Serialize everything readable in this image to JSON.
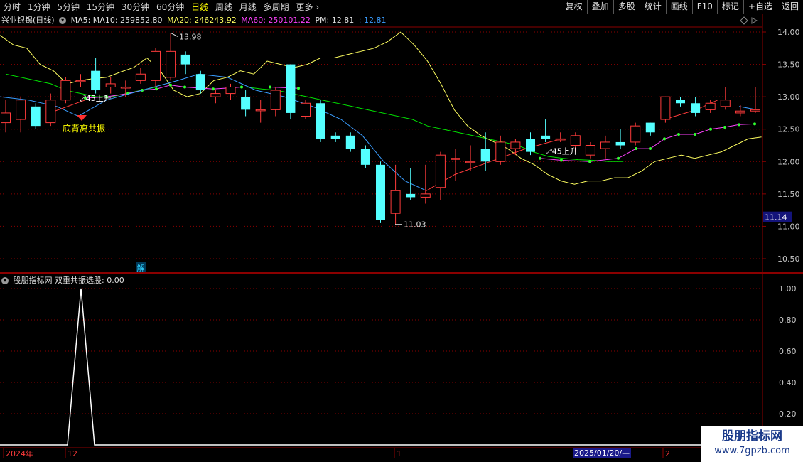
{
  "toolbar": {
    "periods": [
      "分时",
      "1分钟",
      "5分钟",
      "15分钟",
      "30分钟",
      "60分钟",
      "日线",
      "周线",
      "月线",
      "多周期",
      "更多"
    ],
    "active_index": 6,
    "right_buttons": [
      "复权",
      "叠加",
      "多股",
      "统计",
      "画线",
      "F10",
      "标记",
      "+自选",
      "返回"
    ]
  },
  "stock": {
    "name": "兴业银锡(日线)"
  },
  "ma_line": {
    "ma5": "MA5: MA10: 259852.80",
    "ma20": "MA20: 246243.92",
    "ma60": "MA60: 250101.22",
    "pm": "PM: 12.81",
    "pm2": ": 12.81"
  },
  "indicator": {
    "title": "股朋指标网 双重共振选股: 0.00"
  },
  "price_axis": [
    "14.00",
    "13.50",
    "13.00",
    "12.50",
    "12.00",
    "11.50",
    "11.00",
    "10.50"
  ],
  "current_price_tag": "11.14",
  "ind_axis": [
    "1.00",
    "0.80",
    "0.60",
    "0.40",
    "0.20"
  ],
  "annotations": {
    "high": "13.98",
    "low": "11.03",
    "up1": "45上升",
    "up2": "45上升",
    "signal": "底背离共振",
    "jie": "解"
  },
  "date_axis": {
    "year": "2024年",
    "m12": "12",
    "m1": "1",
    "m2": "2",
    "cursor": "2025/01/20/—"
  },
  "watermark": {
    "line1": "股朋指标网",
    "line2": "www.7gpzb.com"
  },
  "colors": {
    "up": "#ff3b3b",
    "down": "#54ffff",
    "ma_yellow": "#ffff60",
    "ma_green": "#00e000",
    "ma_magenta": "#ff40ff",
    "ma_blue": "#3a9dff",
    "grid": "#8b0000"
  },
  "chart_data": {
    "type": "candlestick",
    "candles": [
      {
        "o": 12.6,
        "c": 12.75,
        "h": 12.95,
        "l": 12.45
      },
      {
        "o": 12.65,
        "c": 12.95,
        "h": 13.0,
        "l": 12.45
      },
      {
        "o": 12.85,
        "c": 12.55,
        "h": 12.9,
        "l": 12.5
      },
      {
        "o": 12.6,
        "c": 12.95,
        "h": 13.05,
        "l": 12.55
      },
      {
        "o": 12.95,
        "c": 13.25,
        "h": 13.3,
        "l": 12.9
      },
      {
        "o": 13.25,
        "c": 13.25,
        "h": 13.35,
        "l": 13.15
      },
      {
        "o": 13.4,
        "c": 13.1,
        "h": 13.6,
        "l": 13.05
      },
      {
        "o": 13.15,
        "c": 13.2,
        "h": 13.3,
        "l": 13.05
      },
      {
        "o": 13.15,
        "c": 13.15,
        "h": 13.25,
        "l": 13.0
      },
      {
        "o": 13.25,
        "c": 13.35,
        "h": 13.45,
        "l": 13.2
      },
      {
        "o": 13.25,
        "c": 13.7,
        "h": 13.75,
        "l": 13.15
      },
      {
        "o": 13.3,
        "c": 13.7,
        "h": 13.98,
        "l": 13.25
      },
      {
        "o": 13.65,
        "c": 13.5,
        "h": 13.7,
        "l": 13.35
      },
      {
        "o": 13.35,
        "c": 13.1,
        "h": 13.4,
        "l": 13.05
      },
      {
        "o": 13.0,
        "c": 13.05,
        "h": 13.1,
        "l": 12.9
      },
      {
        "o": 13.05,
        "c": 13.15,
        "h": 13.2,
        "l": 12.95
      },
      {
        "o": 13.0,
        "c": 12.8,
        "h": 13.1,
        "l": 12.7
      },
      {
        "o": 12.8,
        "c": 12.8,
        "h": 12.95,
        "l": 12.6
      },
      {
        "o": 12.8,
        "c": 13.1,
        "h": 13.15,
        "l": 12.7
      },
      {
        "o": 13.5,
        "c": 12.75,
        "h": 13.5,
        "l": 12.65
      },
      {
        "o": 12.7,
        "c": 12.9,
        "h": 12.95,
        "l": 12.65
      },
      {
        "o": 12.9,
        "c": 12.35,
        "h": 12.95,
        "l": 12.3
      },
      {
        "o": 12.4,
        "c": 12.35,
        "h": 12.45,
        "l": 12.3
      },
      {
        "o": 12.4,
        "c": 12.2,
        "h": 12.45,
        "l": 12.15
      },
      {
        "o": 12.2,
        "c": 11.95,
        "h": 12.25,
        "l": 11.9
      },
      {
        "o": 11.95,
        "c": 11.1,
        "h": 12.0,
        "l": 11.05
      },
      {
        "o": 11.2,
        "c": 11.55,
        "h": 11.95,
        "l": 11.03
      },
      {
        "o": 11.5,
        "c": 11.45,
        "h": 11.9,
        "l": 11.4
      },
      {
        "o": 11.45,
        "c": 11.5,
        "h": 11.95,
        "l": 11.35
      },
      {
        "o": 11.6,
        "c": 12.1,
        "h": 12.15,
        "l": 11.4
      },
      {
        "o": 12.05,
        "c": 12.05,
        "h": 12.2,
        "l": 11.7
      },
      {
        "o": 12.0,
        "c": 12.0,
        "h": 12.25,
        "l": 11.85
      },
      {
        "o": 12.2,
        "c": 12.0,
        "h": 12.45,
        "l": 11.85
      },
      {
        "o": 12.0,
        "c": 12.3,
        "h": 12.4,
        "l": 11.95
      },
      {
        "o": 12.2,
        "c": 12.3,
        "h": 12.35,
        "l": 12.1
      },
      {
        "o": 12.35,
        "c": 12.15,
        "h": 12.45,
        "l": 12.1
      },
      {
        "o": 12.4,
        "c": 12.35,
        "h": 12.65,
        "l": 12.3
      },
      {
        "o": 12.35,
        "c": 12.35,
        "h": 12.45,
        "l": 12.3
      },
      {
        "o": 12.25,
        "c": 12.4,
        "h": 12.45,
        "l": 12.15
      },
      {
        "o": 12.1,
        "c": 12.25,
        "h": 12.3,
        "l": 12.05
      },
      {
        "o": 12.2,
        "c": 12.3,
        "h": 12.4,
        "l": 12.05
      },
      {
        "o": 12.3,
        "c": 12.25,
        "h": 12.5,
        "l": 12.2
      },
      {
        "o": 12.3,
        "c": 12.55,
        "h": 12.6,
        "l": 12.25
      },
      {
        "o": 12.6,
        "c": 12.45,
        "h": 12.6,
        "l": 12.4
      },
      {
        "o": 12.65,
        "c": 13.0,
        "h": 13.0,
        "l": 12.6
      },
      {
        "o": 12.95,
        "c": 12.9,
        "h": 13.0,
        "l": 12.85
      },
      {
        "o": 12.9,
        "c": 12.75,
        "h": 13.0,
        "l": 12.7
      },
      {
        "o": 12.8,
        "c": 12.9,
        "h": 12.95,
        "l": 12.75
      },
      {
        "o": 12.85,
        "c": 12.95,
        "h": 13.15,
        "l": 12.8
      },
      {
        "o": 12.75,
        "c": 12.78,
        "h": 12.87,
        "l": 12.7
      },
      {
        "o": 12.78,
        "c": 12.8,
        "h": 13.15,
        "l": 12.75
      }
    ],
    "yellow_line": [
      13.95,
      13.8,
      13.75,
      13.5,
      13.4,
      13.2,
      13.25,
      13.28,
      13.3,
      13.38,
      13.45,
      13.6,
      13.4,
      13.1,
      13.0,
      13.05,
      13.25,
      13.3,
      13.4,
      13.35,
      13.55,
      13.5,
      13.45,
      13.5,
      13.6,
      13.6,
      13.65,
      13.7,
      13.75,
      13.85,
      14.0,
      13.8,
      13.55,
      13.2,
      12.8,
      12.55,
      12.4,
      12.3,
      12.2,
      12.05,
      11.95,
      11.8,
      11.7,
      11.65,
      11.7,
      11.7,
      11.75,
      11.75,
      11.85,
      12.0,
      12.05,
      12.1,
      12.05,
      12.1,
      12.15,
      12.25,
      12.35,
      12.38
    ],
    "green_line": [
      13.35,
      13.3,
      13.25,
      13.2,
      13.1,
      13.05,
      13.0,
      13.0,
      13.05,
      13.1,
      13.15,
      13.15,
      13.15,
      13.15,
      13.15,
      13.15,
      13.15,
      13.12,
      13.1,
      13.05,
      13.0,
      12.95,
      12.9,
      12.85,
      12.8,
      12.75,
      12.7,
      12.65,
      12.55,
      12.5,
      12.45,
      12.4,
      12.35,
      12.3,
      12.25,
      12.15,
      12.08,
      12.05,
      12.03,
      12.02,
      12.0,
      12.0
    ],
    "indicator": [
      0,
      0,
      0,
      0,
      0,
      1.0,
      0,
      0,
      0,
      0
    ]
  }
}
